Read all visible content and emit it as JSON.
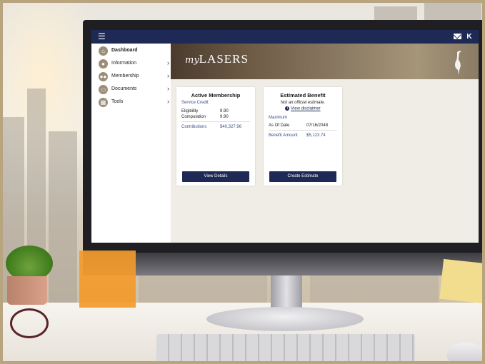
{
  "topbar": {
    "menu_icon": "hamburger-icon",
    "mail_icon": "envelope-icon",
    "user_initial": "K"
  },
  "brand": {
    "prefix": "my",
    "name": "LASERS"
  },
  "sidebar": {
    "items": [
      {
        "label": "Dashboard",
        "icon": "home-icon",
        "active": true,
        "has_submenu": false
      },
      {
        "label": "Information",
        "icon": "person-icon",
        "active": false,
        "has_submenu": true
      },
      {
        "label": "Membership",
        "icon": "group-icon",
        "active": false,
        "has_submenu": true
      },
      {
        "label": "Documents",
        "icon": "document-icon",
        "active": false,
        "has_submenu": true
      },
      {
        "label": "Tools",
        "icon": "calculator-icon",
        "active": false,
        "has_submenu": true
      }
    ]
  },
  "membership_card": {
    "title": "Active Membership",
    "service_credit_label": "Service Credit",
    "eligibility_label": "Eligibility",
    "eligibility_value": "9.90",
    "computation_label": "Computation",
    "computation_value": "9.90",
    "contributions_label": "Contributions",
    "contributions_value": "$40,327.96",
    "button_label": "View Details"
  },
  "benefit_card": {
    "title": "Estimated Benefit",
    "note": "Not an official estimate.",
    "disclaimer_link": "View disclaimer",
    "maximum_label": "Maximum",
    "as_of_label": "As Of Date",
    "as_of_value": "07/16/2048",
    "benefit_label": "Benefit Amount",
    "benefit_value": "$5,123.74",
    "button_label": "Create Estimate"
  },
  "colors": {
    "navy": "#1e2a55",
    "accent_blue": "#3a4f8a",
    "nav_icon": "#9b8e79",
    "frame_gold": "#b8a47e"
  }
}
